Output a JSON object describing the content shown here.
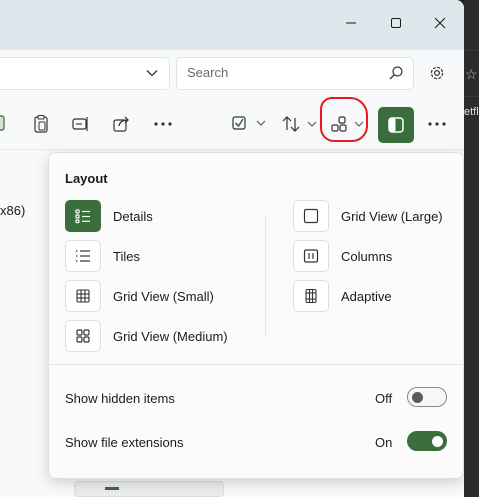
{
  "search": {
    "placeholder": "Search"
  },
  "background_browser": {
    "partial_text": "etfl"
  },
  "file_list": {
    "partial_name": "x86)"
  },
  "layout_flyout": {
    "title": "Layout",
    "options_left": [
      {
        "label": "Details",
        "icon": "details-icon",
        "selected": true
      },
      {
        "label": "Tiles",
        "icon": "tiles-icon",
        "selected": false
      },
      {
        "label": "Grid View (Small)",
        "icon": "grid-small-icon",
        "selected": false
      },
      {
        "label": "Grid View (Medium)",
        "icon": "grid-medium-icon",
        "selected": false
      }
    ],
    "options_right": [
      {
        "label": "Grid View (Large)",
        "icon": "grid-large-icon",
        "selected": false
      },
      {
        "label": "Columns",
        "icon": "columns-icon",
        "selected": false
      },
      {
        "label": "Adaptive",
        "icon": "adaptive-icon",
        "selected": false
      }
    ],
    "show_hidden_items": {
      "label": "Show hidden items",
      "state": "Off",
      "on": false
    },
    "show_file_extensions": {
      "label": "Show file extensions",
      "state": "On",
      "on": true
    }
  },
  "colors": {
    "accent": "#3a6e3c",
    "annotation": "#e8191f",
    "titlebar": "#dde8ec"
  }
}
